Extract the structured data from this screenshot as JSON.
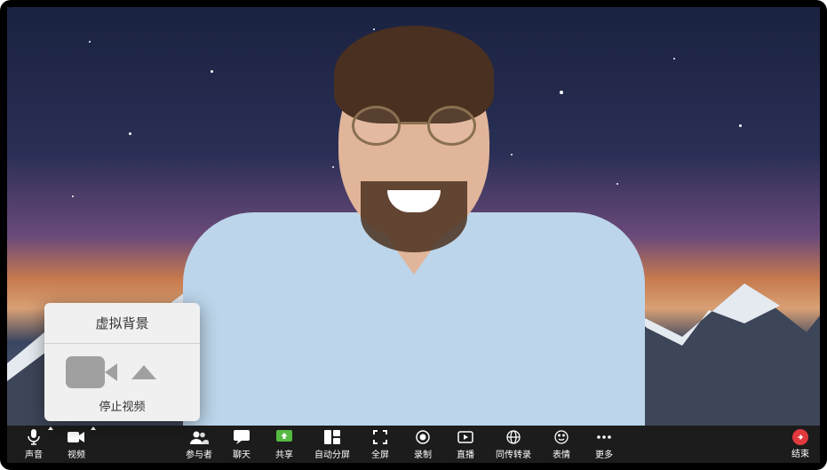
{
  "popup": {
    "header": "虚拟背景",
    "stop_video_label": "停止视频"
  },
  "toolbar": {
    "audio": "声音",
    "video": "视频",
    "participants": "参与者",
    "chat": "聊天",
    "share": "共享",
    "auto_split": "自动分屏",
    "fullscreen": "全屏",
    "record": "录制",
    "live": "直播",
    "interpretation": "同传转录",
    "emoji": "表情",
    "more": "更多",
    "end": "结束"
  },
  "colors": {
    "accent_green": "#55ba42",
    "end_red": "#e0393e",
    "toolbar_bg": "#1c1c1c"
  }
}
